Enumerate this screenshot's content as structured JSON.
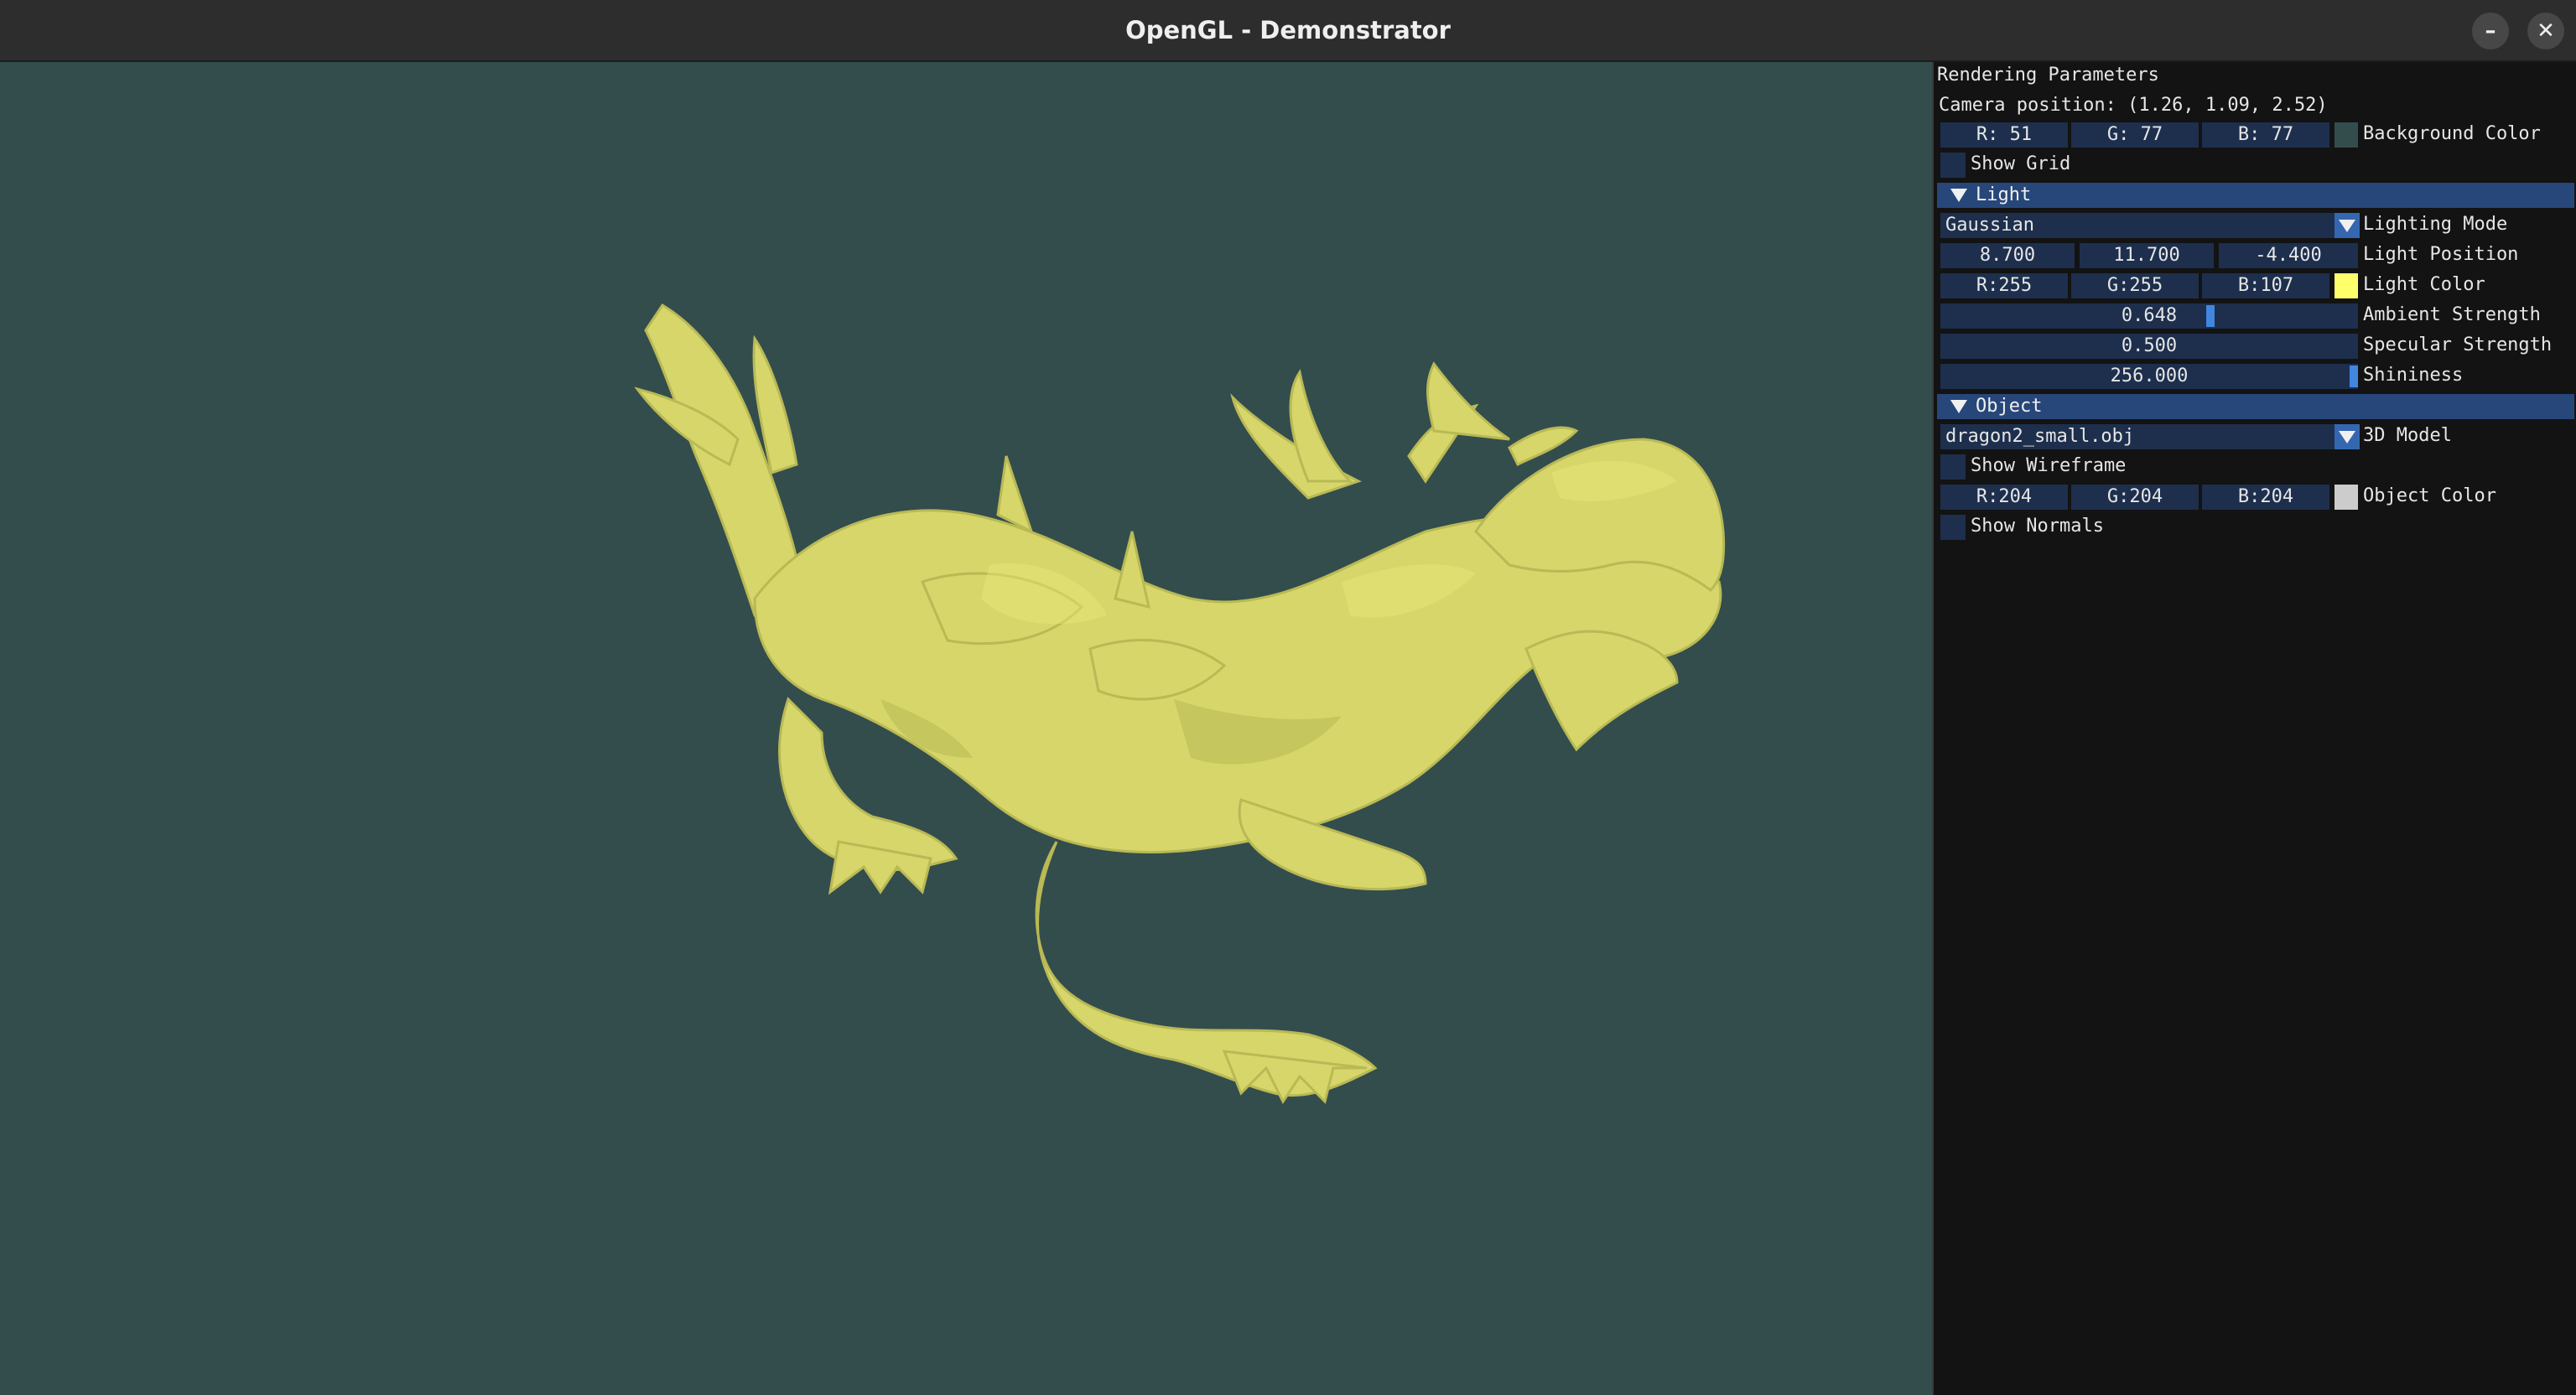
{
  "window": {
    "title": "OpenGL - Demonstrator",
    "minimize_glyph": "–",
    "close_glyph": "✕"
  },
  "viewport": {
    "background_color": "#334d4d",
    "object_color": "#d9d96b",
    "model_subject": "dragon"
  },
  "panel": {
    "title": "Rendering Parameters",
    "camera_position": "Camera position: (1.26, 1.09, 2.52)",
    "background": {
      "r": "R: 51",
      "g": "G: 77",
      "b": "B: 77",
      "swatch": "#334d4d",
      "label": "Background Color"
    },
    "show_grid": {
      "label": "Show Grid",
      "checked": false
    },
    "light": {
      "header": "Light",
      "mode_value": "Gaussian",
      "mode_label": "Lighting Mode",
      "position_x": "8.700",
      "position_y": "11.700",
      "position_z": "-4.400",
      "position_label": "Light Position",
      "color_r": "R:255",
      "color_g": "G:255",
      "color_b": "B:107",
      "color_swatch": "#ffff6b",
      "color_label": "Light Color",
      "ambient_value": "0.648",
      "ambient_fraction": 0.648,
      "ambient_label": "Ambient Strength",
      "specular_value": "0.500",
      "specular_label": "Specular Strength",
      "shininess_value": "256.000",
      "shininess_label": "Shininess"
    },
    "object": {
      "header": "Object",
      "model_value": "dragon2_small.obj",
      "model_label": "3D Model",
      "wireframe_label": "Show Wireframe",
      "color_r": "R:204",
      "color_g": "G:204",
      "color_b": "B:204",
      "color_swatch": "#cccccc",
      "color_label": "Object Color",
      "normals_label": "Show Normals"
    }
  }
}
